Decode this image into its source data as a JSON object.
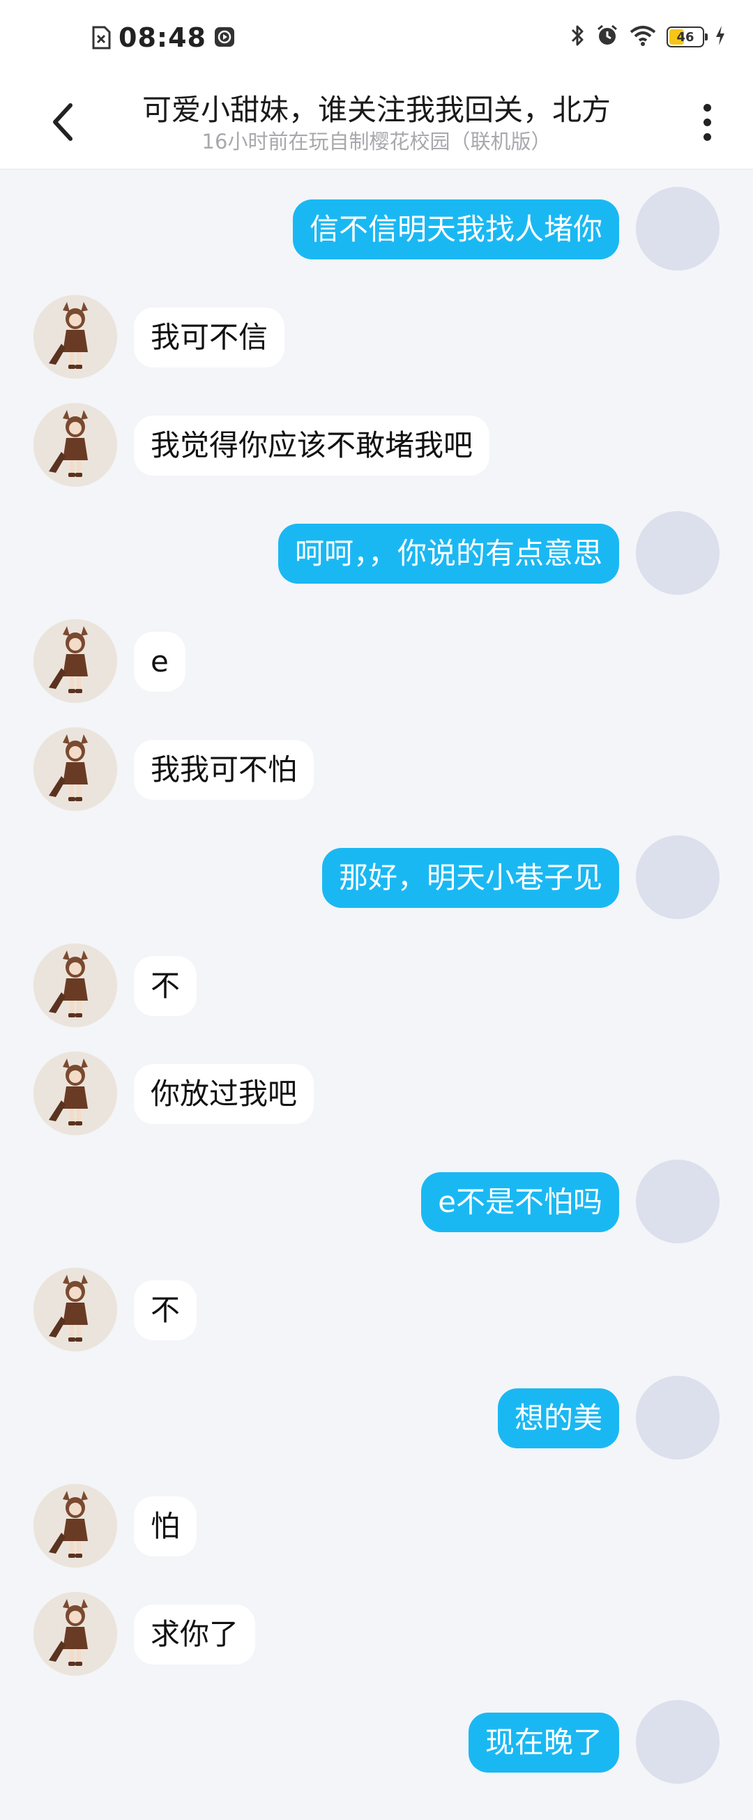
{
  "status_bar": {
    "time": "08:48",
    "battery": "46",
    "battery_level": 0.46
  },
  "header": {
    "title": "可爱小甜妹，谁关注我我回关，北方",
    "subtitle": "16小时前在玩自制樱花校园（联机版）"
  },
  "colors": {
    "outgoing_bubble": "#1ab8f3",
    "incoming_bubble": "#ffffff",
    "background": "#f3f5f8"
  },
  "messages": [
    {
      "side": "out",
      "text": "信不信明天我找人堵你"
    },
    {
      "side": "in",
      "text": "我可不信"
    },
    {
      "side": "in",
      "text": "我觉得你应该不敢堵我吧"
    },
    {
      "side": "out",
      "text": "呵呵，，你说的有点意思"
    },
    {
      "side": "in",
      "text": "e"
    },
    {
      "side": "in",
      "text": "我我可不怕"
    },
    {
      "side": "out",
      "text": "那好，明天小巷子见"
    },
    {
      "side": "in",
      "text": "不"
    },
    {
      "side": "in",
      "text": "你放过我吧"
    },
    {
      "side": "out",
      "text": "e不是不怕吗"
    },
    {
      "side": "in",
      "text": "不"
    },
    {
      "side": "out",
      "text": "想的美"
    },
    {
      "side": "in",
      "text": "怕"
    },
    {
      "side": "in",
      "text": "求你了"
    },
    {
      "side": "out",
      "text": "现在晚了"
    }
  ]
}
